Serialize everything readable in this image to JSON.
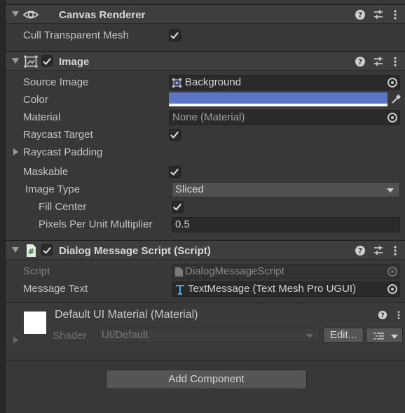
{
  "canvas_renderer": {
    "title": "Canvas Renderer",
    "cull_label": "Cull Transparent Mesh",
    "cull_checked": true
  },
  "image": {
    "title": "Image",
    "enabled": true,
    "source_image_label": "Source Image",
    "source_image_value": "Background",
    "color_label": "Color",
    "color_value": "#5a74c6",
    "material_label": "Material",
    "material_value": "None (Material)",
    "raycast_target_label": "Raycast Target",
    "raycast_padding_label": "Raycast Padding",
    "maskable_label": "Maskable",
    "image_type_label": "Image Type",
    "image_type_value": "Sliced",
    "fill_center_label": "Fill Center",
    "ppu_label": "Pixels Per Unit Multiplier",
    "ppu_value": "0.5"
  },
  "dialog_script": {
    "title": "Dialog Message Script (Script)",
    "enabled": true,
    "script_label": "Script",
    "script_value": "DialogMessageScript",
    "message_text_label": "Message Text",
    "message_text_value": "TextMessage (Text Mesh Pro UGUI)"
  },
  "material": {
    "title": "Default UI Material (Material)",
    "shader_label": "Shader",
    "shader_value": "UI/Default",
    "edit_label": "Edit..."
  },
  "add_component_label": "Add Component",
  "colors": {
    "accent_color_swatch": "#5a74c6"
  }
}
